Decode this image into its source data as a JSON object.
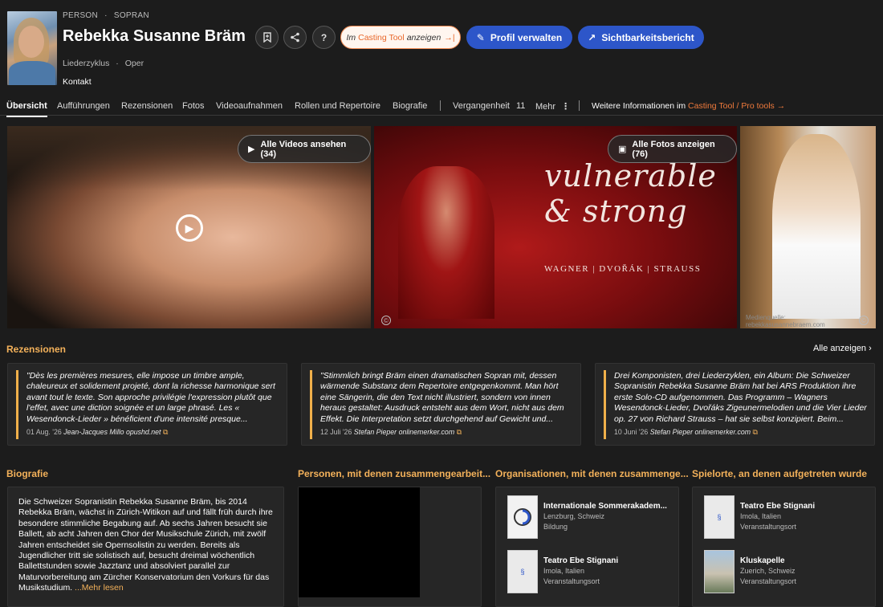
{
  "header": {
    "kind_a": "PERSON",
    "kind_sep": "·",
    "kind_b": "SOPRAN",
    "name": "Rebekka Susanne Bräm",
    "sub_a": "Liederzyklus",
    "sub_sep": "·",
    "sub_b": "Oper",
    "contact": "Kontakt",
    "casting_pre": "Im",
    "casting_hl": "Casting Tool",
    "casting_post": "anzeigen",
    "manage": "Profil verwalten",
    "visibility": "Sichtbarkeitsbericht",
    "icons": [
      "bookmark-icon",
      "share-icon",
      "help-icon",
      "external-arrow-icon",
      "pencil-icon",
      "trend-icon"
    ]
  },
  "nav": {
    "tabs": [
      "Übersicht",
      "Aufführungen",
      "Rezensionen",
      "Fotos",
      "Videoaufnahmen",
      "Rollen und Repertoire",
      "Biografie"
    ],
    "past_label": "Vergangenheit",
    "past_count": "11",
    "more": "Mehr",
    "more_info_pre": "Weitere Informationen im",
    "more_info_hl": "Casting Tool / Pro tools",
    "more_info_arrow": "→"
  },
  "media": {
    "videos_btn": "Alle Videos ansehen (34)",
    "photos_btn": "Alle Fotos anzeigen (76)",
    "album_line1": "vulnerable",
    "album_line2": "& strong",
    "album_sub": "WAGNER | DVOŘÁK | STRAUSS",
    "source_label": "Medienquelle:",
    "source_value": "rebekkasusannebraem.com",
    "copyright": "©"
  },
  "reviews": {
    "title": "Rezensionen",
    "all": "Alle anzeigen",
    "items": [
      {
        "text": "\"Dès les premières mesures, elle impose un timbre ample, chaleureux et solidement projeté, dont la richesse harmonique sert avant tout le texte. Son approche privilégie l'expression plutôt que l'effet, avec une diction soignée et un large phrasé. Les « Wesendonck-Lieder » bénéficient d'une intensité presque...",
        "date": "01 Aug. '26",
        "author": "Jean-Jacques Millo",
        "source": "opushd.net"
      },
      {
        "text": "\"Stimmlich bringt Bräm einen dramatischen Sopran mit, dessen wärmende Substanz dem Repertoire entgegenkommt. Man hört eine Sängerin, die den Text nicht illustriert, sondern von innen heraus gestaltet: Ausdruck entsteht aus dem Wort, nicht aus dem Effekt. Die Interpretation setzt durchgehend auf Gewicht und...",
        "date": "12 Juli '26",
        "author": "Stefan Pieper",
        "source": "onlinemerker.com"
      },
      {
        "text": "Drei Komponisten, drei Liederzyklen, ein Album: Die Schweizer Sopranistin Rebekka Susanne Bräm hat bei ARS Produktion ihre erste Solo-CD aufgenommen. Das Programm – Wagners Wesendonck-Lieder, Dvořáks Zigeunermelodien und die Vier Lieder op. 27 von Richard Strauss – hat sie selbst konzipiert. Beim...",
        "date": "10 Juni '26",
        "author": "Stefan Pieper",
        "source": "onlinemerker.com"
      }
    ]
  },
  "bio": {
    "title": "Biografie",
    "text": "Die Schweizer Sopranistin Rebekka Susanne Bräm, bis 2014 Rebekka Bräm, wächst in Zürich-Witikon auf und fällt früh durch ihre besondere stimmliche Begabung auf. Ab sechs Jahren besucht sie Ballett, ab acht Jahren den Chor der Musikschule Zürich, mit zwölf Jahren entscheidet sie Opernsolistin zu werden. Bereits als Jugendlicher tritt sie solistisch auf, besucht dreimal wöchentlich Ballettstunden sowie Jazztanz und absolviert parallel zur Maturvorbereitung am Zürcher Konservatorium den Vorkurs für das Musikstudium.",
    "more": "...Mehr lesen"
  },
  "people": {
    "title": "Personen, mit denen zusammengearbeit..."
  },
  "orgs": {
    "title": "Organisationen, mit denen zusammenge...",
    "items": [
      {
        "name": "Internationale Sommerakadem...",
        "loc": "Lenzburg, Schweiz",
        "cat": "Bildung"
      },
      {
        "name": "Teatro Ebe Stignani",
        "loc": "Imola, Italien",
        "cat": "Veranstaltungsort"
      }
    ]
  },
  "venues": {
    "title": "Spielorte, an denen aufgetreten wurde",
    "items": [
      {
        "name": "Teatro Ebe Stignani",
        "loc": "Imola, Italien",
        "cat": "Veranstaltungsort"
      },
      {
        "name": "Kluskapelle",
        "loc": "Zuerich, Schweiz",
        "cat": "Veranstaltungsort"
      }
    ]
  }
}
